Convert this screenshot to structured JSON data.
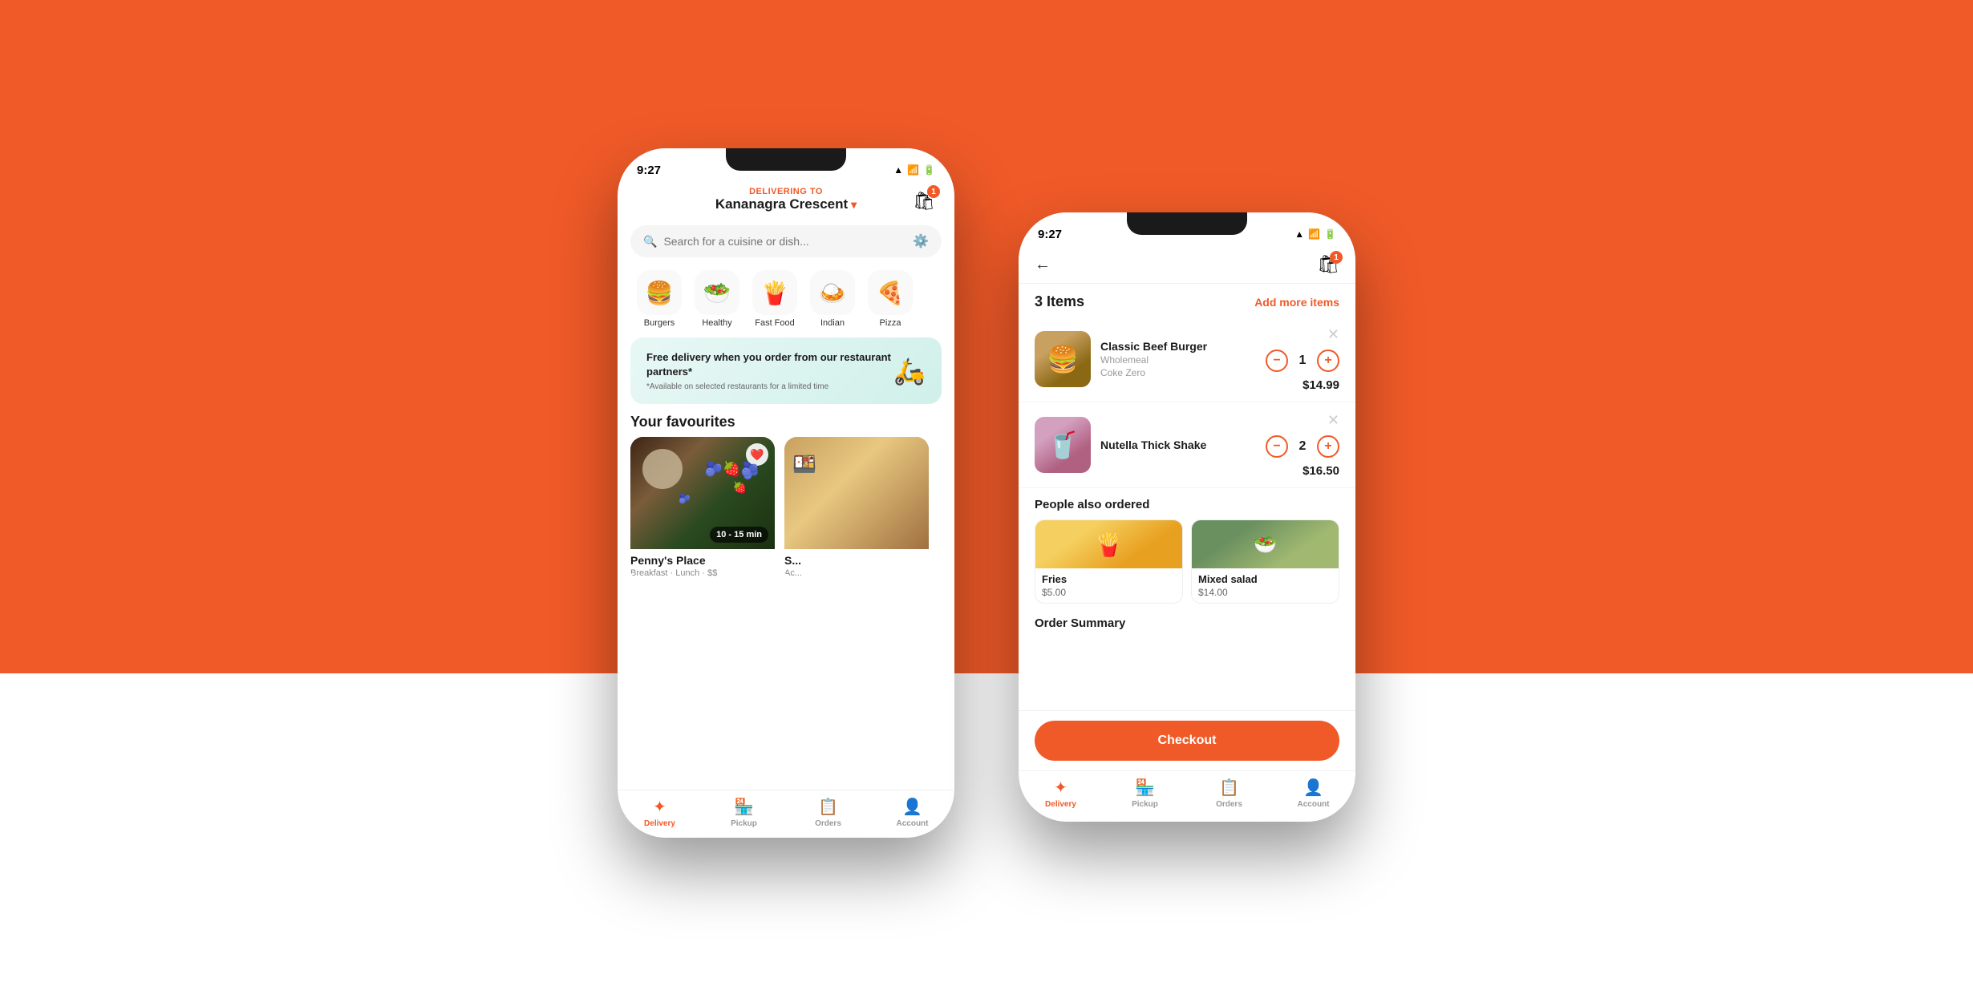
{
  "page": {
    "background_top": "#f05a28",
    "background_bottom": "#ffffff"
  },
  "phone_left": {
    "status_bar": {
      "time": "9:27",
      "icons": "▲ WiFi Battery"
    },
    "header": {
      "delivering_label": "DELIVERING TO",
      "address": "Kananagra Crescent",
      "chevron": "▾",
      "cart_badge": "1"
    },
    "search": {
      "placeholder": "Search for a cuisine or dish..."
    },
    "categories": [
      {
        "id": "burgers",
        "emoji": "🍔",
        "label": "Burgers"
      },
      {
        "id": "healthy",
        "emoji": "🥗",
        "label": "Healthy"
      },
      {
        "id": "fast-food",
        "emoji": "🍟",
        "label": "Fast Food"
      },
      {
        "id": "indian",
        "emoji": "🍛",
        "label": "Indian"
      },
      {
        "id": "pizza",
        "emoji": "🍕",
        "label": "Pizza"
      }
    ],
    "promo_banner": {
      "main": "Free delivery when you order from our restaurant partners*",
      "sub": "*Available on selected restaurants for a limited time",
      "icon": "🛵"
    },
    "favourites": {
      "title": "Your favourites",
      "items": [
        {
          "name": "Penny's Place",
          "sub": "Breakfast · Lunch · $$",
          "time": "10 - 15 min",
          "liked": true
        },
        {
          "name": "S...",
          "sub": "...",
          "time": "",
          "liked": false
        }
      ]
    },
    "bottom_nav": [
      {
        "id": "delivery",
        "icon": "🍽",
        "label": "Delivery",
        "active": true
      },
      {
        "id": "pickup",
        "icon": "🏪",
        "label": "Pickup",
        "active": false
      },
      {
        "id": "orders",
        "icon": "📋",
        "label": "Orders",
        "active": false
      },
      {
        "id": "account",
        "icon": "👤",
        "label": "Account",
        "active": false
      }
    ]
  },
  "phone_right": {
    "status_bar": {
      "time": "9:27",
      "icons": "▲ WiFi Battery"
    },
    "header": {
      "back_icon": "←",
      "cart_icon": "🛍",
      "cart_badge": "1"
    },
    "cart": {
      "items_label": "3 Items",
      "add_more": "Add more items",
      "items": [
        {
          "id": "burger",
          "name": "Classic Beef Burger",
          "desc1": "Wholemeal",
          "desc2": "Coke Zero",
          "qty": 1,
          "price": "$14.99"
        },
        {
          "id": "shake",
          "name": "Nutella Thick Shake",
          "desc1": "",
          "desc2": "",
          "qty": 2,
          "price": "$16.50"
        }
      ]
    },
    "people_ordered": {
      "title": "People also ordered",
      "items": [
        {
          "id": "fries",
          "name": "Fries",
          "price": "$5.00",
          "emoji": "🍟"
        },
        {
          "id": "salad",
          "name": "Mixed salad",
          "price": "$14.00",
          "emoji": "🥗"
        }
      ]
    },
    "order_summary": {
      "title": "Order Summary"
    },
    "checkout": {
      "button_label": "Checkout"
    },
    "bottom_nav": [
      {
        "id": "delivery",
        "icon": "🍽",
        "label": "Delivery",
        "active": true
      },
      {
        "id": "pickup",
        "icon": "🏪",
        "label": "Pickup",
        "active": false
      },
      {
        "id": "orders",
        "icon": "📋",
        "label": "Orders",
        "active": false
      },
      {
        "id": "account",
        "icon": "👤",
        "label": "Account",
        "active": false
      }
    ]
  }
}
